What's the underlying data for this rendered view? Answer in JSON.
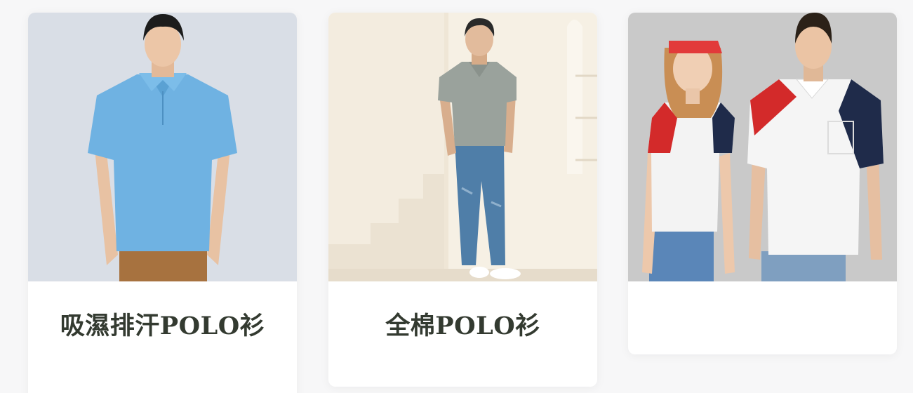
{
  "products": [
    {
      "title": "吸濕排汗POLO衫",
      "image_alt": "blue polo shirt model"
    },
    {
      "title": "全棉POLO衫",
      "image_alt": "grey cotton polo shirt model"
    },
    {
      "title": "",
      "image_alt": "red white navy polo shirts couple"
    }
  ],
  "colors": {
    "title_text": "#333a30",
    "card_bg": "#ffffff",
    "page_bg": "#f7f7f8"
  }
}
